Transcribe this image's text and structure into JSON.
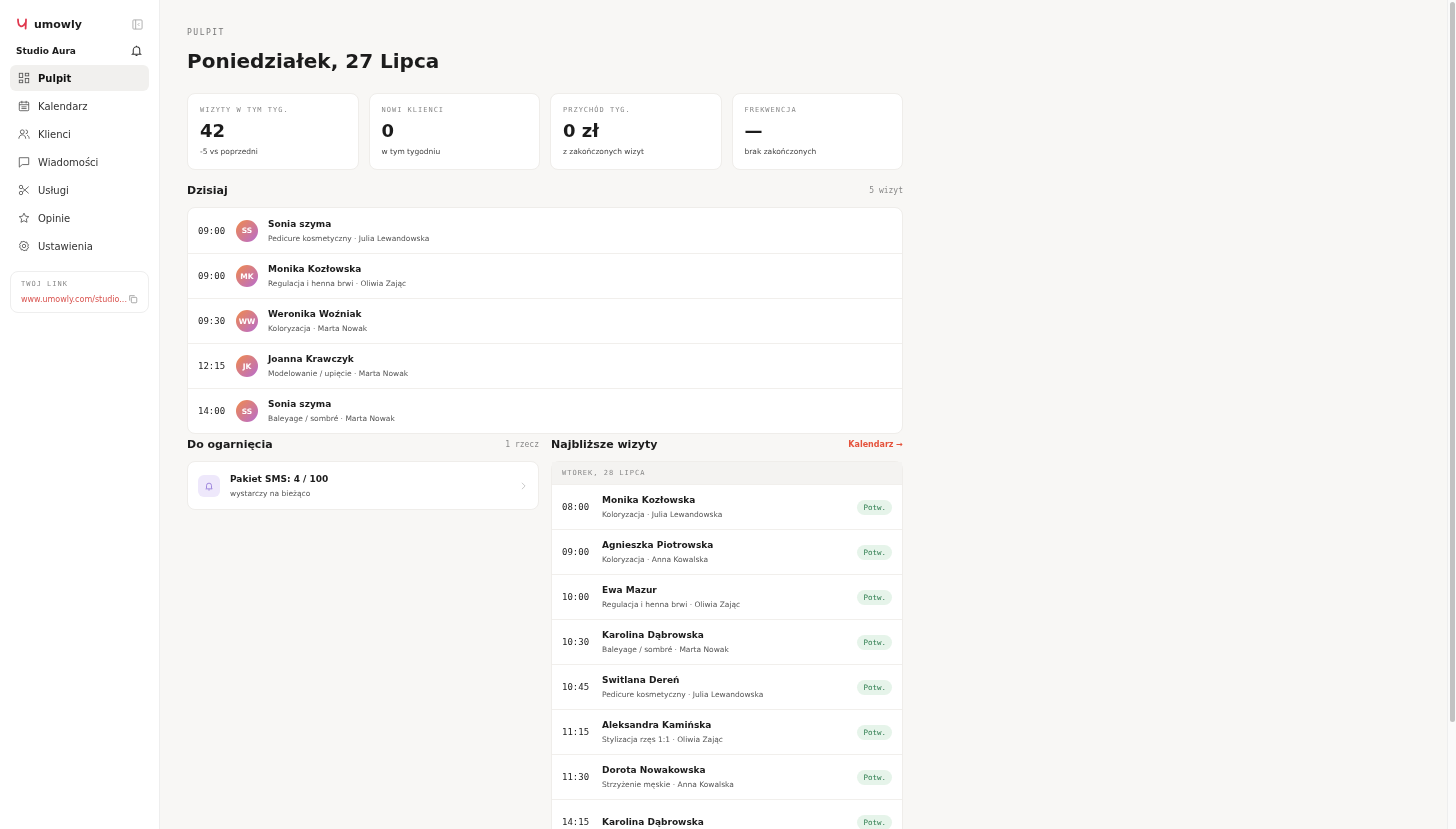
{
  "sidebar": {
    "logo": "umowly",
    "studio": "Studio Aura",
    "items": [
      {
        "label": "Pulpit",
        "selected": true
      },
      {
        "label": "Kalendarz",
        "selected": false
      },
      {
        "label": "Klienci",
        "selected": false
      },
      {
        "label": "Wiadomości",
        "selected": false
      },
      {
        "label": "Usługi",
        "selected": false
      },
      {
        "label": "Opinie",
        "selected": false
      },
      {
        "label": "Ustawienia",
        "selected": false
      }
    ],
    "link": {
      "label": "TWOJ LINK",
      "url": "www.umowly.com/studio..."
    }
  },
  "breadcrumb": "PULPIT",
  "title": "Poniedziałek, 27 Lipca",
  "stats": [
    {
      "label": "WIZYTY W TYM TYG.",
      "value": "42",
      "note": "-5 vs poprzedni"
    },
    {
      "label": "NOWI KLIENCI",
      "value": "0",
      "note": "w tym tygodniu"
    },
    {
      "label": "PRZYCHÓD TYG.",
      "value": "0 zł",
      "note": "z zakończonych wizyt"
    },
    {
      "label": "FREKWENCJA",
      "value": "—",
      "note": "brak zakończonych"
    }
  ],
  "today": {
    "title": "Dzisiaj",
    "count": "5 wizyt",
    "rows": [
      {
        "time": "09:00",
        "initials": "SS",
        "name": "Sonia szyma",
        "detail": "Pedicure kosmetyczny · Julia Lewandowska"
      },
      {
        "time": "09:00",
        "initials": "MK",
        "name": "Monika Kozłowska",
        "detail": "Regulacja i henna brwi · Oliwia Zając"
      },
      {
        "time": "09:30",
        "initials": "WW",
        "name": "Weronika Woźniak",
        "detail": "Koloryzacja · Marta Nowak"
      },
      {
        "time": "12:15",
        "initials": "JK",
        "name": "Joanna Krawczyk",
        "detail": "Modelowanie / upięcie · Marta Nowak"
      },
      {
        "time": "14:00",
        "initials": "SS",
        "name": "Sonia szyma",
        "detail": "Baleyage / sombré · Marta Nowak"
      }
    ]
  },
  "todo": {
    "title": "Do ogarnięcia",
    "count": "1 rzecz",
    "items": [
      {
        "title": "Pakiet SMS: 4 / 100",
        "detail": "wystarczy na bieżąco"
      }
    ]
  },
  "upcoming": {
    "title": "Najbliższe wizyty",
    "link": "Kalendarz →",
    "day": "WTOREK, 28 LIPCA",
    "rows": [
      {
        "time": "08:00",
        "name": "Monika Kozłowska",
        "detail": "Koloryzacja · Julia Lewandowska",
        "status": "Potw."
      },
      {
        "time": "09:00",
        "name": "Agnieszka Piotrowska",
        "detail": "Koloryzacja · Anna Kowalska",
        "status": "Potw."
      },
      {
        "time": "10:00",
        "name": "Ewa Mazur",
        "detail": "Regulacja i henna brwi · Oliwia Zając",
        "status": "Potw."
      },
      {
        "time": "10:30",
        "name": "Karolina Dąbrowska",
        "detail": "Baleyage / sombré · Marta Nowak",
        "status": "Potw."
      },
      {
        "time": "10:45",
        "name": "Switlana Dereń",
        "detail": "Pedicure kosmetyczny · Julia Lewandowska",
        "status": "Potw."
      },
      {
        "time": "11:15",
        "name": "Aleksandra Kamińska",
        "detail": "Stylizacja rzęs 1:1 · Oliwia Zając",
        "status": "Potw."
      },
      {
        "time": "11:30",
        "name": "Dorota Nowakowska",
        "detail": "Strzyżenie męskie · Anna Kowalska",
        "status": "Potw."
      },
      {
        "time": "14:15",
        "name": "Karolina Dąbrowska",
        "status": "Potw."
      }
    ]
  }
}
